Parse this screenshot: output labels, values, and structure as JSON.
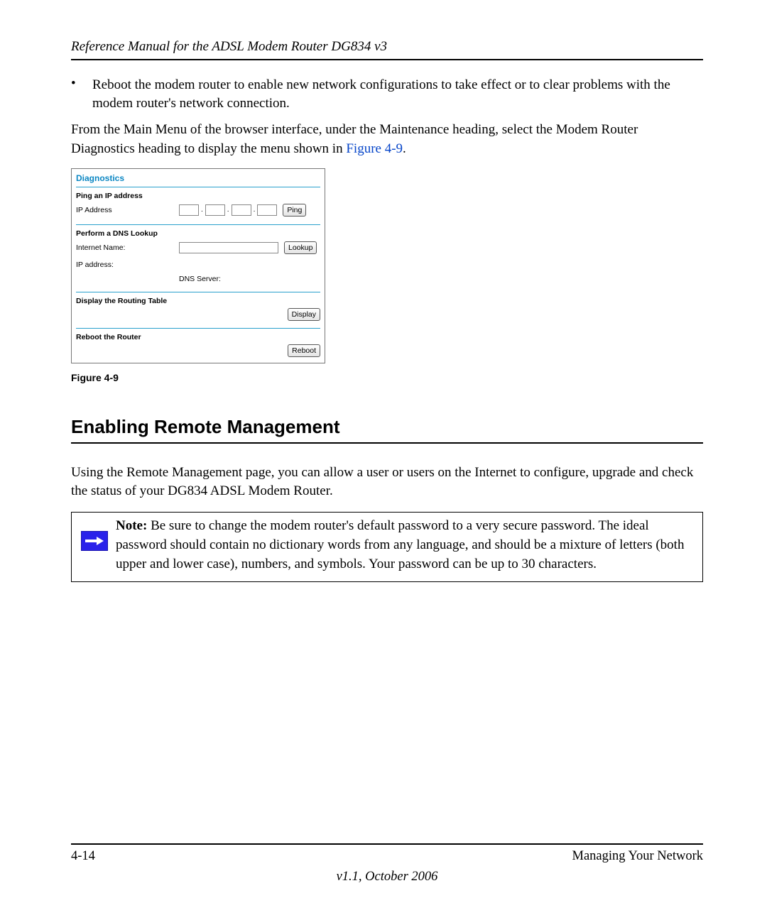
{
  "header": {
    "title": "Reference Manual for the ADSL Modem Router DG834 v3"
  },
  "bullet": "Reboot the modem router to enable new network configurations to take effect or to clear problems with the modem router's network connection.",
  "intro_paragraph_before_link": "From the Main Menu of the browser interface, under the Maintenance heading, select the Modem Router Diagnostics heading to display the menu shown in ",
  "figure_link": "Figure 4-9",
  "intro_paragraph_after_link": ".",
  "ui": {
    "title": "Diagnostics",
    "ping_section": "Ping an IP address",
    "ip_label": "IP Address",
    "ping_button": "Ping",
    "dns_section": "Perform a DNS Lookup",
    "internet_name_label": "Internet Name:",
    "lookup_button": "Lookup",
    "ip_address_label": "IP address:",
    "dns_server_label": "DNS Server:",
    "routing_section": "Display the Routing Table",
    "display_button": "Display",
    "reboot_section": "Reboot the Router",
    "reboot_button": "Reboot"
  },
  "figure_caption": "Figure 4-9",
  "section_heading": "Enabling Remote Management",
  "section_paragraph": "Using the Remote Management page, you can allow a user or users on the Internet to configure, upgrade and check the status of your DG834 ADSL Modem Router.",
  "note": {
    "label": "Note:",
    "body": " Be sure to change the modem router's default password to a very secure password. The ideal password should contain no dictionary words from any language, and should be a mixture of letters (both upper and lower case), numbers, and symbols. Your password can be up to 30 characters."
  },
  "footer": {
    "page_num": "4-14",
    "chapter": "Managing Your Network",
    "version": "v1.1, October 2006"
  }
}
